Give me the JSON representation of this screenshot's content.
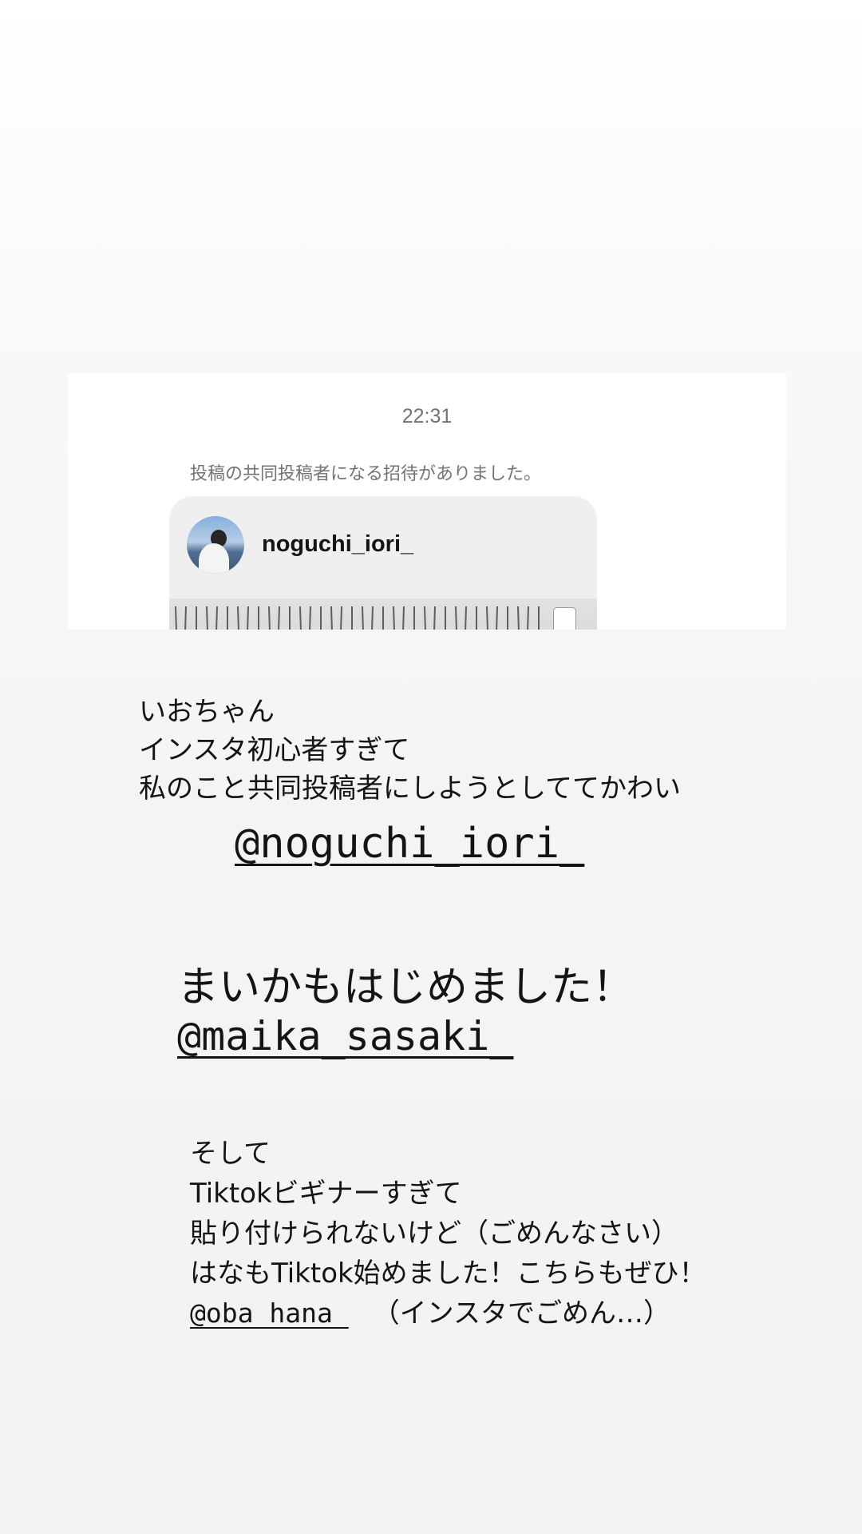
{
  "dm_card": {
    "time": "22:31",
    "notice": "投稿の共同投稿者になる招待がありました。",
    "post_preview": {
      "username": "noguchi_iori_"
    }
  },
  "story": {
    "caption_1": [
      "いおちゃん",
      "インスタ初心者すぎて",
      "私のこと共同投稿者にしようとしててかわい"
    ],
    "mention_1": "@noguchi_iori_",
    "caption_2": "まいかもはじめました！",
    "mention_2": "@maika_sasaki_",
    "caption_3": [
      "そして",
      "Tiktokビギナーすぎて",
      "貼り付けられないけど（ごめんなさい）",
      "はなもTiktok始めました！こちらもぜひ！"
    ],
    "mention_3": "@oba_hana_",
    "apology": "（インスタでごめん…）"
  }
}
